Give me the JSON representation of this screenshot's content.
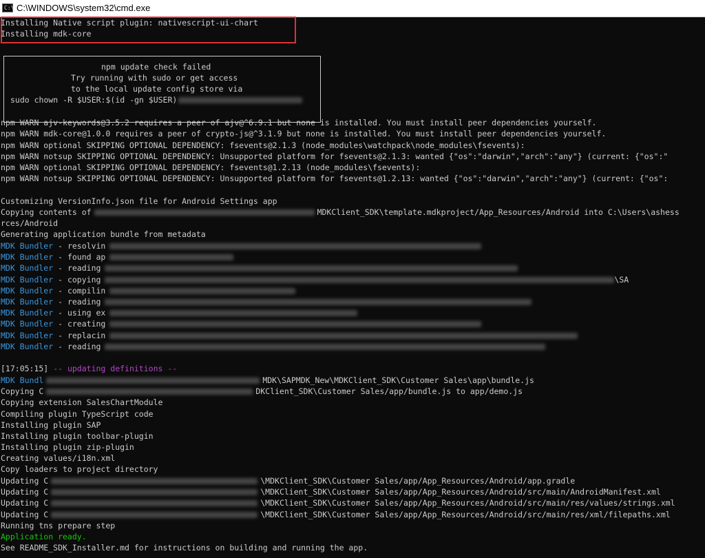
{
  "window": {
    "title": "C:\\WINDOWS\\system32\\cmd.exe",
    "icon_label": "C:\\"
  },
  "console": {
    "highlighted": [
      "Installing Native script plugin: nativescript-ui-chart",
      "Installing mdk-core"
    ],
    "update_box": {
      "line1": "npm update check failed",
      "line2": "Try running with sudo or get access",
      "line3": "to the local update config store via",
      "line4": "sudo chown -R $USER:$(id -gn $USER)"
    },
    "warnings": [
      "npm WARN ajv-keywords@3.5.2 requires a peer of ajv@^6.9.1 but none is installed. You must install peer dependencies yourself.",
      "npm WARN mdk-core@1.0.0 requires a peer of crypto-js@^3.1.9 but none is installed. You must install peer dependencies yourself.",
      "npm WARN optional SKIPPING OPTIONAL DEPENDENCY: fsevents@2.1.3 (node_modules\\watchpack\\node_modules\\fsevents):",
      "npm WARN notsup SKIPPING OPTIONAL DEPENDENCY: Unsupported platform for fsevents@2.1.3: wanted {\"os\":\"darwin\",\"arch\":\"any\"} (current: {\"os\":\"",
      "npm WARN optional SKIPPING OPTIONAL DEPENDENCY: fsevents@1.2.13 (node_modules\\fsevents):",
      "npm WARN notsup SKIPPING OPTIONAL DEPENDENCY: Unsupported platform for fsevents@1.2.13: wanted {\"os\":\"darwin\",\"arch\":\"any\"} (current: {\"os\":"
    ],
    "customizing": "Customizing VersionInfo.json file for Android Settings app",
    "copying_prefix": "Copying contents of",
    "copying_suffix": "MDKClient_SDK\\template.mdkproject/App_Resources/Android into C:\\Users\\ashess",
    "copying_cont": "rces/Android",
    "generating": "Generating application bundle from metadata",
    "bundler_label": "MDK Bundler",
    "bundler_steps": [
      "- resolvin",
      "- found ap",
      "- reading",
      "- copying",
      "- compilin",
      "- reading",
      "- using ex",
      "- creating",
      "- replacin",
      "- reading"
    ],
    "bundler_tail_4": "\\SA",
    "timestamp": "[17:05:15]",
    "updating_definitions": "-- updating definitions --",
    "bundler_short": "MDK Bundl",
    "bundle_path": "MDK\\SAPMDK_New\\MDKClient_SDK\\Customer Sales\\app\\bundle.js",
    "copying_c": "Copying C",
    "copying_c_suffix": "DKClient_SDK\\Customer Sales/app/bundle.js to app/demo.js",
    "steps": [
      "Copying extension SalesChartModule",
      "Compiling plugin TypeScript code",
      "Installing plugin SAP",
      "Installing plugin toolbar-plugin",
      "Installing plugin zip-plugin",
      "Creating values/i18n.xml",
      "Copy loaders to project directory"
    ],
    "updating_prefix": "Updating C",
    "updates": [
      "\\MDKClient_SDK\\Customer Sales/app/App_Resources/Android/app.gradle",
      "\\MDKClient_SDK\\Customer Sales/app/App_Resources/Android/src/main/AndroidManifest.xml",
      "\\MDKClient_SDK\\Customer Sales/app/App_Resources/Android/src/main/res/values/strings.xml",
      "\\MDKClient_SDK\\Customer Sales/app/App_Resources/Android/src/main/res/xml/filepaths.xml"
    ],
    "tns_prepare": "Running tns prepare step",
    "app_ready": "Application ready.",
    "readme": "See README_SDK_Installer.md for instructions on building and running the app."
  }
}
